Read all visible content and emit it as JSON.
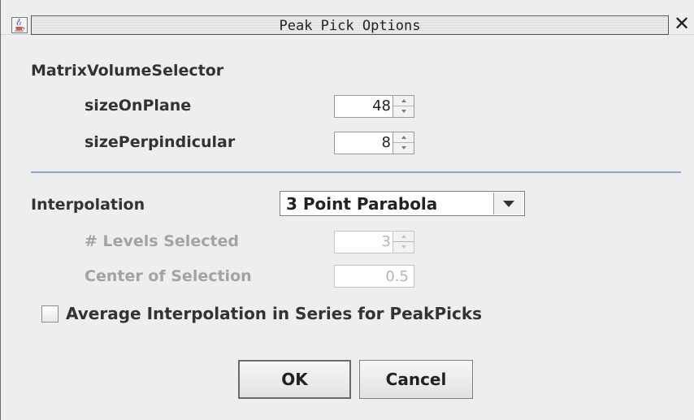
{
  "window": {
    "title": "Peak Pick Options",
    "icon": "java-cup-icon",
    "close_glyph": "✕"
  },
  "matrix": {
    "heading": "MatrixVolumeSelector",
    "size_on_plane": {
      "label": "sizeOnPlane",
      "value": "48"
    },
    "size_perpendicular": {
      "label": "sizePerpindicular",
      "value": "8"
    }
  },
  "interpolation": {
    "label": "Interpolation",
    "selected": "3 Point Parabola",
    "levels": {
      "label": "# Levels Selected",
      "value": "3",
      "enabled": false
    },
    "center": {
      "label": "Center of Selection",
      "value": "0.5",
      "enabled": false
    }
  },
  "average_checkbox": {
    "label": "Average Interpolation in Series for PeakPicks",
    "checked": false
  },
  "buttons": {
    "ok": "OK",
    "cancel": "Cancel"
  },
  "colors": {
    "separator": "#8ea5d0",
    "background": "#eeeeee",
    "disabled_text": "#a3a3a3"
  }
}
